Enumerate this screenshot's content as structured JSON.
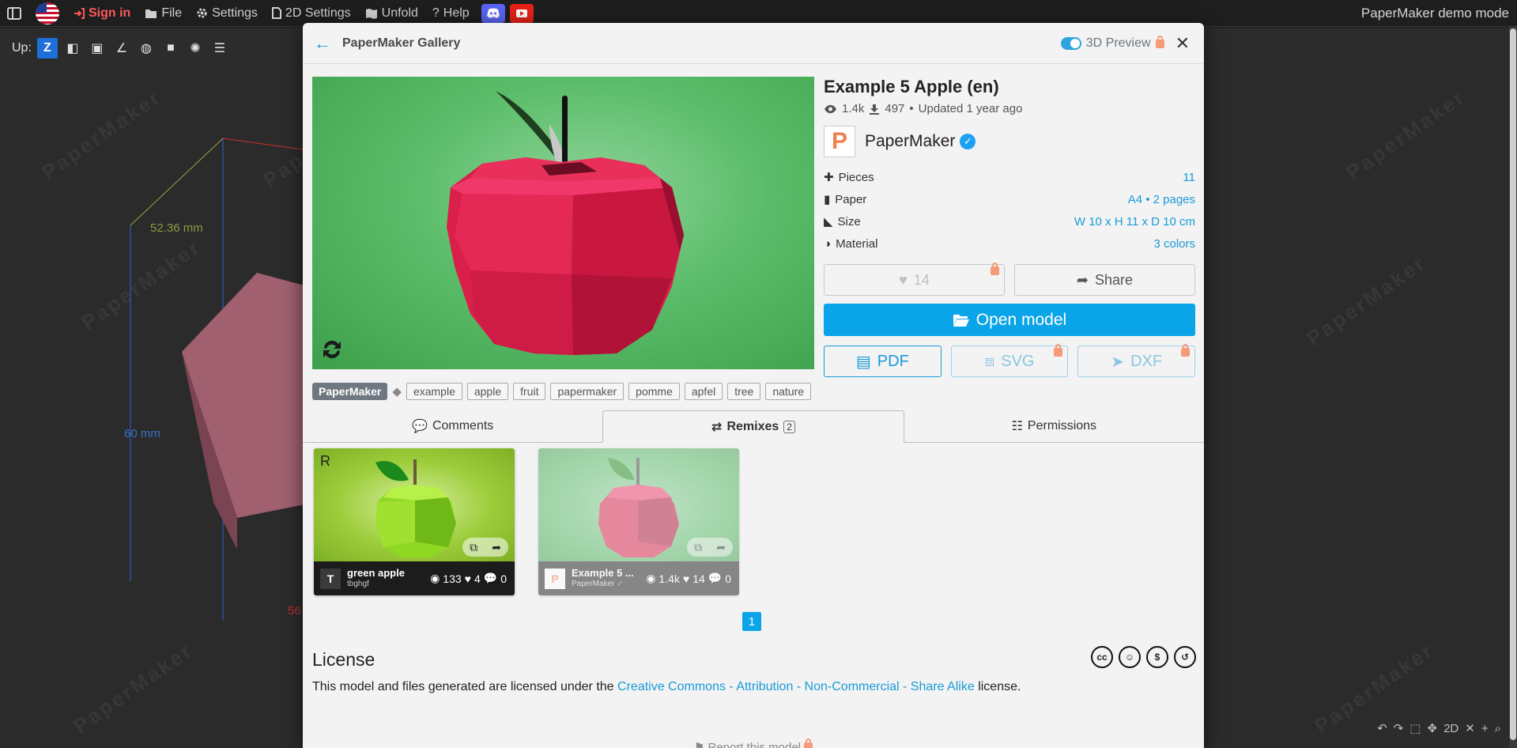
{
  "menubar": {
    "signin": "Sign in",
    "file": "File",
    "settings": "Settings",
    "settings2d": "2D Settings",
    "unfold": "Unfold",
    "help": "Help",
    "demo_title": "PaperMaker demo mode"
  },
  "toolbar3d": {
    "up_label": "Up:",
    "axis": "Z"
  },
  "viewport": {
    "watermark": "PaperMaker",
    "dims": [
      "52.36 mm",
      "60 mm",
      "56"
    ]
  },
  "modal": {
    "title": "PaperMaker Gallery",
    "preview_toggle": "3D Preview",
    "model": {
      "title": "Example 5 Apple (en)",
      "views": "1.4k",
      "downloads": "497",
      "updated": "Updated 1 year ago",
      "author_initial": "P",
      "author": "PaperMaker",
      "specs": [
        {
          "label": "Pieces",
          "value": "11"
        },
        {
          "label": "Paper",
          "value": "A4 • 2 pages"
        },
        {
          "label": "Size",
          "value": "W 10 x H 11 x D 10 cm"
        },
        {
          "label": "Material",
          "value": "3 colors"
        }
      ],
      "likes": "14",
      "share": "Share",
      "open": "Open model",
      "pdf": "PDF",
      "svg": "SVG",
      "dxf": "DXF"
    },
    "tags": {
      "main": "PaperMaker",
      "list": [
        "example",
        "apple",
        "fruit",
        "papermaker",
        "pomme",
        "apfel",
        "tree",
        "nature"
      ]
    },
    "tabs": {
      "comments": "Comments",
      "remixes": "Remixes",
      "remix_count": "2",
      "permissions": "Permissions"
    },
    "remixes": [
      {
        "badge": "R",
        "initial": "T",
        "name": "green apple",
        "author": "tbghgf",
        "views": "133",
        "likes": "4",
        "comments": "0"
      },
      {
        "initial": "P",
        "name": "Example 5 ...",
        "author": "PaperMaker",
        "views": "1.4k",
        "likes": "14",
        "comments": "0"
      }
    ],
    "page": "1",
    "license": {
      "heading": "License",
      "prefix": "This model and files generated are licensed under the",
      "link": "Creative Commons - Attribution - Non-Commercial - Share Alike",
      "suffix": "license."
    },
    "report": "Report this model"
  },
  "colors": {
    "accent": "#0aa4e8",
    "apple": "#d9204a",
    "bg_green": "#5bbd6a"
  }
}
